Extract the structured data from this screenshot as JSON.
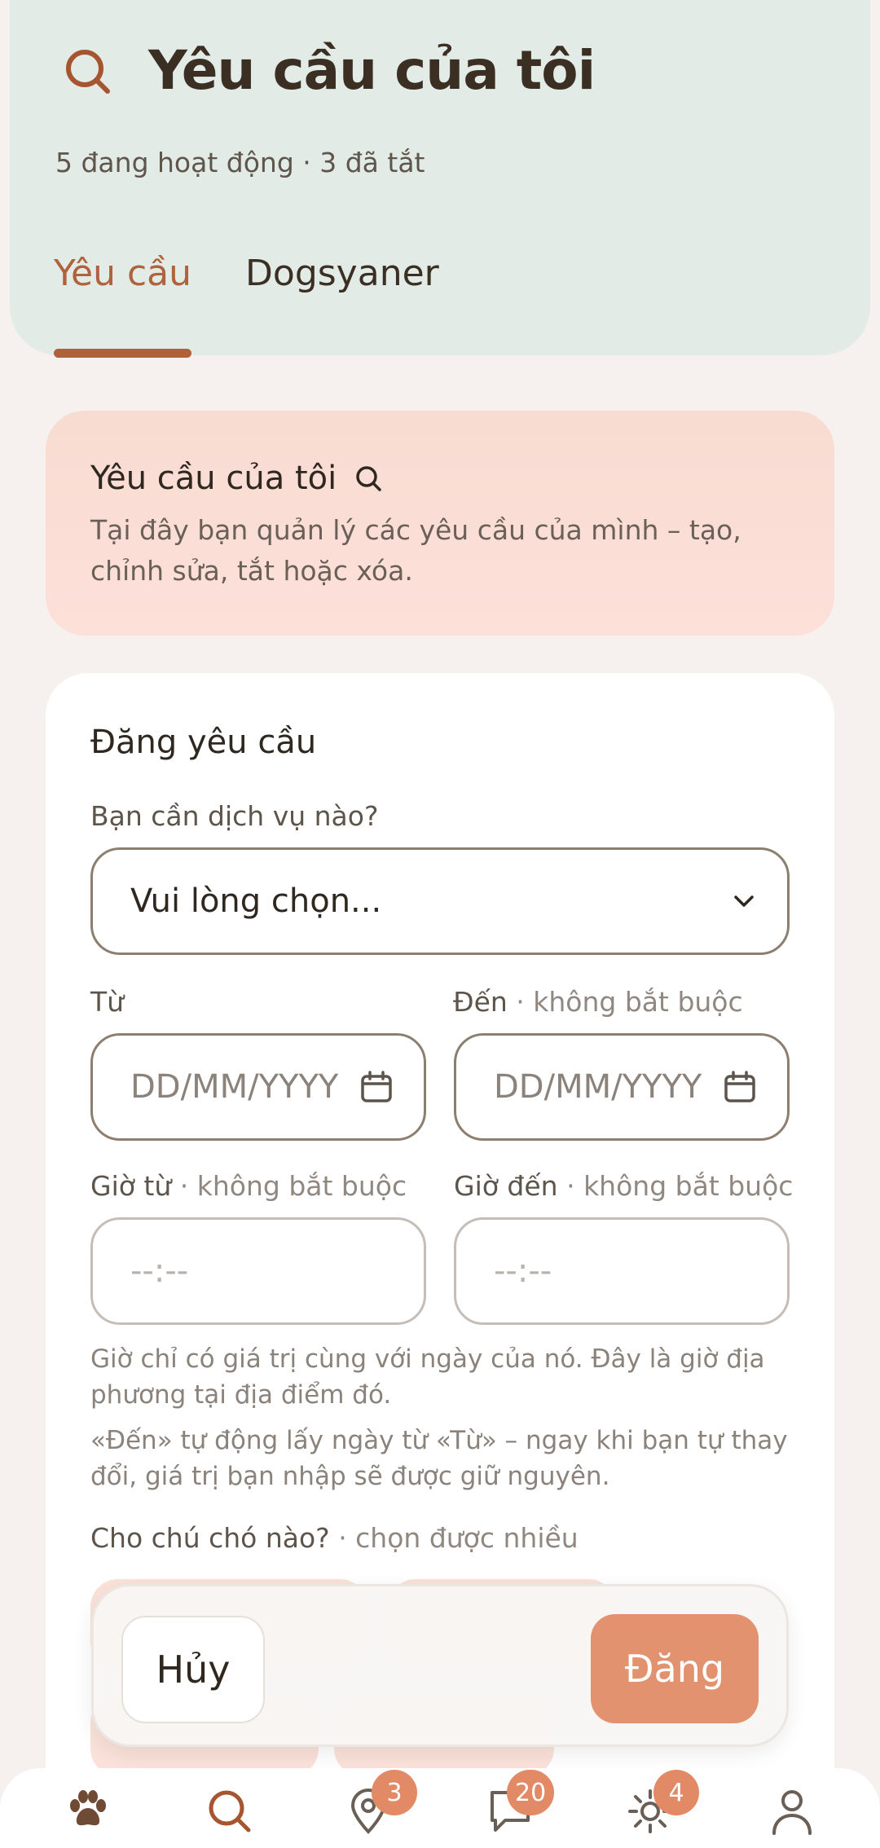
{
  "header": {
    "title": "Yêu cầu của tôi",
    "subtitle": "5 đang hoạt động · 3 đã tắt",
    "tabs": [
      {
        "label": "Yêu cầu",
        "active": true
      },
      {
        "label": "Dogsyaner",
        "active": false
      }
    ]
  },
  "info_card": {
    "title": "Yêu cầu của tôi",
    "text": "Tại đây bạn quản lý các yêu cầu của mình – tạo, chỉnh sửa, tắt hoặc xóa."
  },
  "form": {
    "title": "Đăng yêu cầu",
    "service": {
      "label": "Bạn cần dịch vụ nào?",
      "value": "Vui lòng chọn..."
    },
    "date_from": {
      "label": "Từ",
      "placeholder": "DD/MM/YYYY"
    },
    "date_to": {
      "label": "Đến",
      "optional": "· không bắt buộc",
      "placeholder": "DD/MM/YYYY"
    },
    "time_from": {
      "label": "Giờ từ",
      "optional": "· không bắt buộc",
      "placeholder": "--:--"
    },
    "time_to": {
      "label": "Giờ đến",
      "optional": "· không bắt buộc",
      "placeholder": "--:--"
    },
    "note1": "Giờ chỉ có giá trị cùng với ngày của nó. Đây là giờ địa phương tại địa điểm đó.",
    "note2": "«Đến» tự động lấy ngày từ «Từ» – ngay khi bạn tự thay đổi, giá trị bạn nhập sẽ được giữ nguyên.",
    "dogs": {
      "label": "Cho chú chó nào?",
      "optional": "· chọn được nhiều"
    }
  },
  "actions": {
    "cancel": "Hủy",
    "submit": "Đăng"
  },
  "nav": {
    "items": [
      {
        "icon": "paw-icon",
        "active": false
      },
      {
        "icon": "search-icon",
        "active": true
      },
      {
        "icon": "map-pin-icon",
        "badge": "3"
      },
      {
        "icon": "chat-icon",
        "badge": "20"
      },
      {
        "icon": "sun-icon",
        "badge": "4"
      },
      {
        "icon": "user-icon"
      }
    ]
  },
  "colors": {
    "accent": "#b0603a",
    "button": "#e39270",
    "header_bg": "#e3ebe6",
    "info_bg": "#fde0d9"
  }
}
